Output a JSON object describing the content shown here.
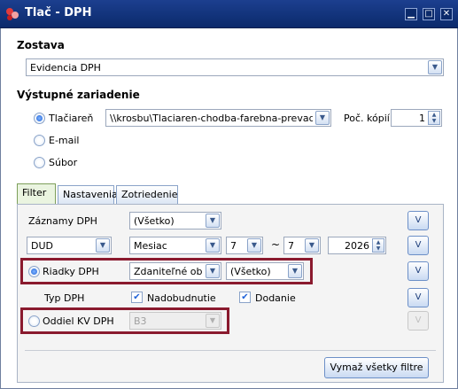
{
  "window": {
    "title": "Tlač - DPH",
    "controls": {
      "minimize": "▁",
      "maximize": "□",
      "close": "✕"
    }
  },
  "report": {
    "section_label": "Zostava",
    "value": "Evidencia DPH"
  },
  "output": {
    "section_label": "Výstupné zariadenie",
    "options": [
      {
        "label": "Tlačiareň",
        "checked": true
      },
      {
        "label": "E-mail",
        "checked": false
      },
      {
        "label": "Súbor",
        "checked": false
      }
    ],
    "printer": "\\\\krosbu\\Tlaciaren-chodba-farebna-prevadzka (P",
    "copies_label": "Poč. kópií",
    "copies": "1"
  },
  "tabs": [
    {
      "label": "Filter",
      "active": true
    },
    {
      "label": "Nastavenia",
      "active": false
    },
    {
      "label": "Zotriedenie",
      "active": false
    }
  ],
  "filter": {
    "records_label": "Záznamy DPH",
    "records_value": "(Všetko)",
    "period_type": "DUD",
    "period_unit": "Mesiac",
    "period_from": "7",
    "period_sep": "~",
    "period_to": "7",
    "year": "2026",
    "rows_label": "Riadky DPH",
    "rows_type": "Zdaniteľné obchc",
    "rows_value": "(Všetko)",
    "dph_type_label": "Typ DPH",
    "dph_acquisition": "Nadobudnutie",
    "dph_delivery": "Dodanie",
    "department_label": "Oddiel KV DPH",
    "department_value": "B3",
    "v_label": "V",
    "clear_button": "Vymaž všetky filtre"
  },
  "colors": {
    "titlebar": "#0b2a6b",
    "highlight": "#8a1a2e",
    "accent": "#1f62d8"
  }
}
